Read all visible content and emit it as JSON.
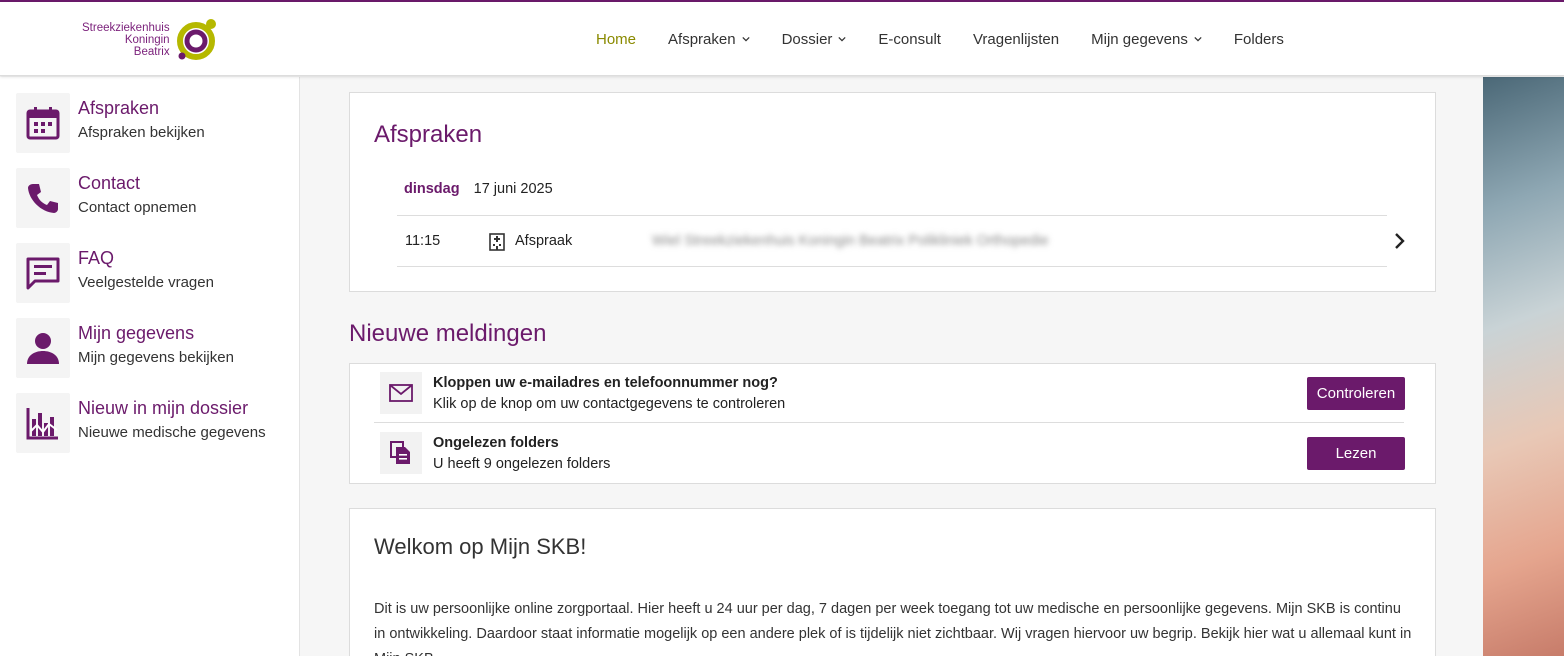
{
  "brand": {
    "name_lines": [
      "Streekziekenhuis",
      "Koningin",
      "Beatrix"
    ],
    "accent": "#6b1a6b",
    "logo_ring": "#b5b800"
  },
  "nav": {
    "items": [
      {
        "label": "Home",
        "active": true,
        "dropdown": false
      },
      {
        "label": "Afspraken",
        "dropdown": true
      },
      {
        "label": "Dossier",
        "dropdown": true
      },
      {
        "label": "E-consult",
        "dropdown": false
      },
      {
        "label": "Vragenlijsten",
        "dropdown": false
      },
      {
        "label": "Mijn gegevens",
        "dropdown": true
      },
      {
        "label": "Folders",
        "dropdown": false
      }
    ]
  },
  "sidebar": {
    "items": [
      {
        "title": "Afspraken",
        "subtitle": "Afspraken bekijken",
        "icon": "calendar-icon"
      },
      {
        "title": "Contact",
        "subtitle": "Contact opnemen",
        "icon": "phone-icon"
      },
      {
        "title": "FAQ",
        "subtitle": "Veelgestelde vragen",
        "icon": "chat-icon"
      },
      {
        "title": "Mijn gegevens",
        "subtitle": "Mijn gegevens bekijken",
        "icon": "person-icon"
      },
      {
        "title": "Nieuw in mijn dossier",
        "subtitle": "Nieuwe medische gegevens",
        "icon": "chart-icon"
      }
    ]
  },
  "appointments": {
    "title": "Afspraken",
    "day": "dinsdag",
    "date": "17 juni 2025",
    "rows": [
      {
        "time": "11:15",
        "type": "Afspraak",
        "location": "Wiel Streekziekenhuis Koningin Beatrix Polikliniek Orthopedie",
        "icon": "hospital-icon"
      }
    ]
  },
  "notifications": {
    "title": "Nieuwe meldingen",
    "items": [
      {
        "title": "Kloppen uw e-mailadres en telefoonnummer nog?",
        "subtitle": "Klik op de knop om uw contactgegevens te controleren",
        "button": "Controleren",
        "icon": "mail-icon"
      },
      {
        "title": "Ongelezen folders",
        "subtitle": "U heeft 9 ongelezen folders",
        "button": "Lezen",
        "icon": "documents-icon"
      }
    ]
  },
  "welcome": {
    "title": "Welkom op Mijn SKB!",
    "body": "Dit is uw persoonlijke online zorgportaal. Hier heeft u 24 uur per dag, 7 dagen per week toegang tot uw medische en persoonlijke gegevens. Mijn SKB is continu in ontwikkeling. Daardoor staat informatie mogelijk op een andere plek of is tijdelijk niet zichtbaar. Wij vragen hiervoor uw begrip. Bekijk hier wat u allemaal kunt in Mijn SKB."
  }
}
